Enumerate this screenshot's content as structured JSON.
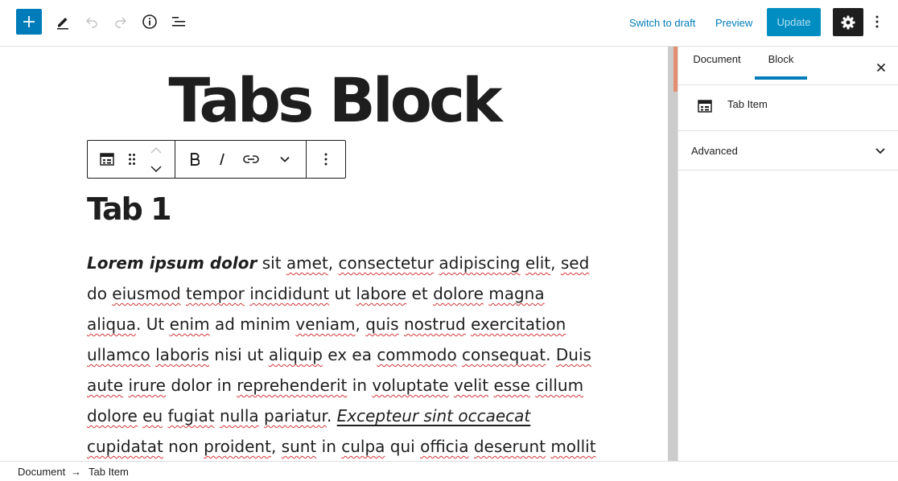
{
  "topbar": {
    "switch_to_draft_label": "Switch to draft",
    "preview_label": "Preview",
    "update_label": "Update",
    "icons": [
      "plus-icon",
      "pencil-icon",
      "undo-icon",
      "redo-icon",
      "info-icon",
      "list-view-icon",
      "gear-icon",
      "more-vertical-icon"
    ]
  },
  "editor": {
    "post_title": "Tabs Block",
    "block_toolbar": {
      "icons": [
        "tab-item-icon",
        "drag-handle-icon",
        "move-up-icon",
        "move-down-icon",
        "bold-icon",
        "italic-icon",
        "link-icon",
        "chevron-down-icon",
        "more-vertical-icon"
      ]
    },
    "heading": "Tab 1",
    "paragraph": {
      "line1_bi": "Lorem ipsum dolor",
      "line1_a": " sit ",
      "line1_b": "amet",
      "line1_c": ", ",
      "line1_d": "consectetur",
      "line1_e": " ",
      "line1_f": "adipiscing",
      "line1_g": " ",
      "line1_h": "elit",
      "line1_i": ", ",
      "line1_j": "sed",
      "line2_a": "do ",
      "line2_b": "eiusmod",
      "line2_c": " ",
      "line2_d": "tempor",
      "line2_e": " ",
      "line2_f": "incididunt",
      "line2_g": " ut ",
      "line2_h": "labore",
      "line2_i": " et ",
      "line2_j": "dolore",
      "line2_k": " ",
      "line2_l": "magna",
      "line3_a": "aliqua",
      "line3_b": ". Ut ",
      "line3_c": "enim",
      "line3_d": " ad minim ",
      "line3_e": "veniam",
      "line3_f": ", ",
      "line3_g": "quis",
      "line3_h": " ",
      "line3_i": "nostrud",
      "line3_j": " ",
      "line3_k": "exercitation",
      "line4_a": "ullamco",
      "line4_b": " ",
      "line4_c": "laboris",
      "line4_d": " nisi ut ",
      "line4_e": "aliquip",
      "line4_f": " ex ea ",
      "line4_g": "commodo",
      "line4_h": " ",
      "line4_i": "consequat",
      "line4_j": ". ",
      "line4_k": "Duis",
      "line5_a": "aute",
      "line5_b": " ",
      "line5_c": "irure",
      "line5_d": " dolor in ",
      "line5_e": "reprehenderit",
      "line5_f": " in ",
      "line5_g": "voluptate",
      "line5_h": " ",
      "line5_i": "velit",
      "line5_j": " ",
      "line5_k": "esse",
      "line5_l": " ",
      "line5_m": "cillum",
      "line6_a": "dolore",
      "line6_b": " ",
      "line6_c": "eu",
      "line6_d": " ",
      "line6_e": "fugiat",
      "line6_f": " ",
      "line6_g": "nulla",
      "line6_h": " ",
      "line6_i": "pariatur",
      "line6_j": ". ",
      "line6_k": "Excepteur sint occaecat",
      "line7_a": "cupidatat",
      "line7_b": " non ",
      "line7_c": "proident",
      "line7_d": ", ",
      "line7_e": "sunt",
      "line7_f": " in ",
      "line7_g": "culpa",
      "line7_h": " qui ",
      "line7_i": "officia",
      "line7_j": " ",
      "line7_k": "deserunt",
      "line7_l": " ",
      "line7_m": "mollit"
    }
  },
  "sidebar": {
    "tabs": [
      {
        "label": "Document",
        "active": false
      },
      {
        "label": "Block",
        "active": true
      }
    ],
    "block_card_title": "Tab Item",
    "panels": [
      {
        "title": "Advanced"
      }
    ]
  },
  "footer": {
    "breadcrumb": [
      "Document",
      "Tab Item"
    ],
    "separator": "→"
  },
  "colors": {
    "accent": "#007cba",
    "update_bg": "#008ec2",
    "dark": "#1e1e1e",
    "spell_underline": "#d63638",
    "scroll_accent": "#e48d70"
  }
}
